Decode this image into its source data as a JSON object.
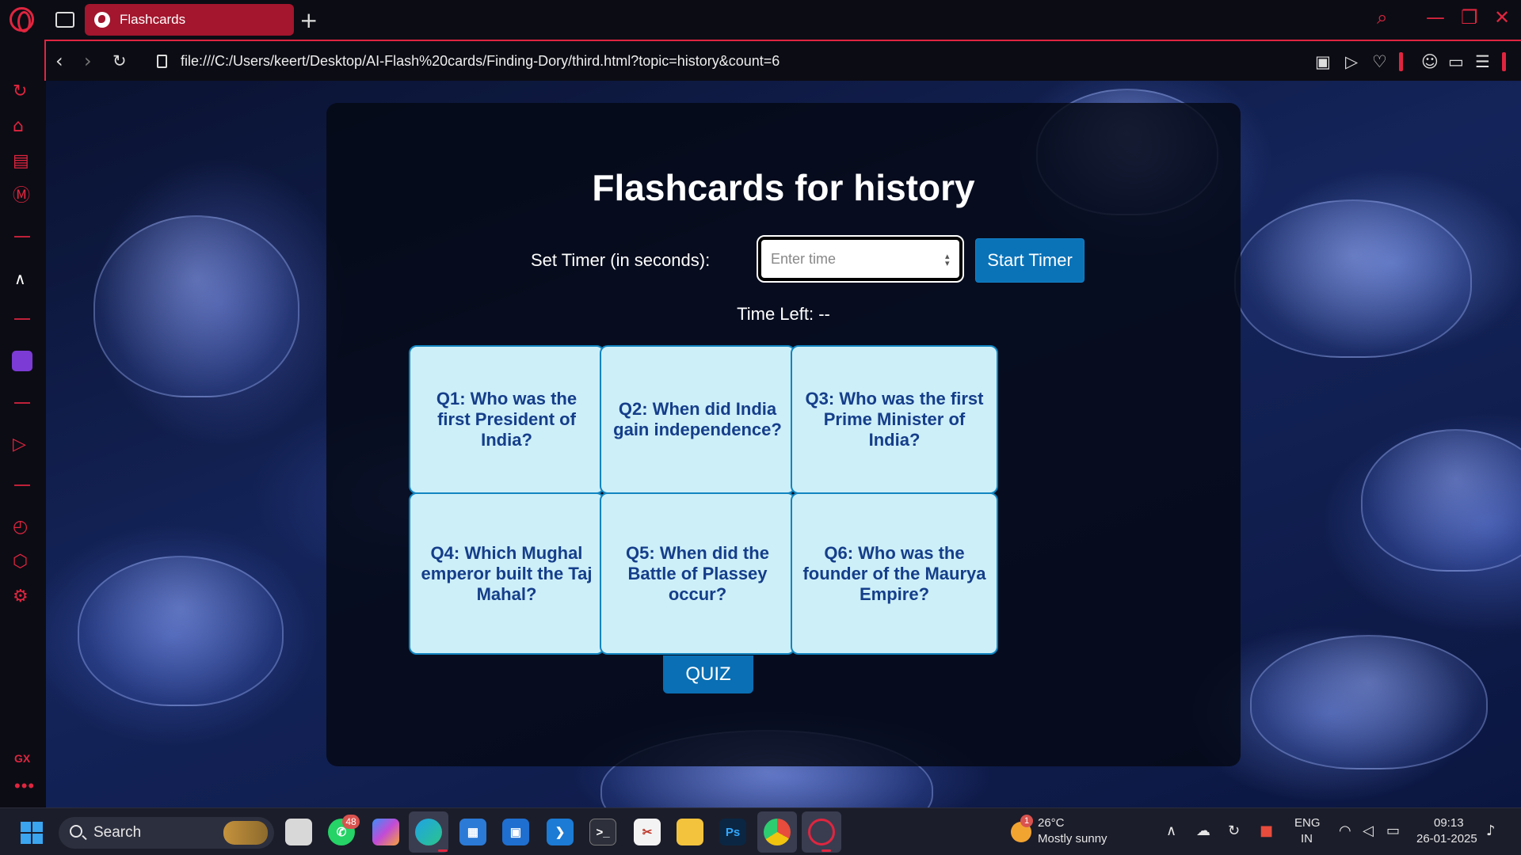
{
  "browser": {
    "tab_title": "Flashcards",
    "url": "file:///C:/Users/keert/Desktop/AI-Flash%20cards/Finding-Dory/third.html?topic=history&count=6",
    "accent_color": "#e0253f"
  },
  "page": {
    "title": "Flashcards for history",
    "timer_label": "Set Timer (in seconds):",
    "timer_placeholder": "Enter time",
    "start_button": "Start Timer",
    "time_left": "Time Left: --",
    "cards": [
      "Q1: Who was the first President of India?",
      "Q2: When did India gain independence?",
      "Q3: Who was the first Prime Minister of India?",
      "Q4: Which Mughal emperor built the Taj Mahal?",
      "Q5: When did the Battle of Plassey occur?",
      "Q6: Who was the founder of the Maurya Empire?"
    ],
    "quiz_button": "QUIZ",
    "card_color": "#cdeff8",
    "card_text_color": "#153e8a"
  },
  "sidebar": {
    "gx_label": "GX",
    "more_label": "•••"
  },
  "taskbar": {
    "search_label": "Search",
    "whatsapp_badge": "48",
    "ps_label": "Ps",
    "weather_badge": "1",
    "temperature": "26°C",
    "weather": "Mostly sunny",
    "lang_top": "ENG",
    "lang_bottom": "IN",
    "time": "09:13",
    "date": "26-01-2025"
  }
}
